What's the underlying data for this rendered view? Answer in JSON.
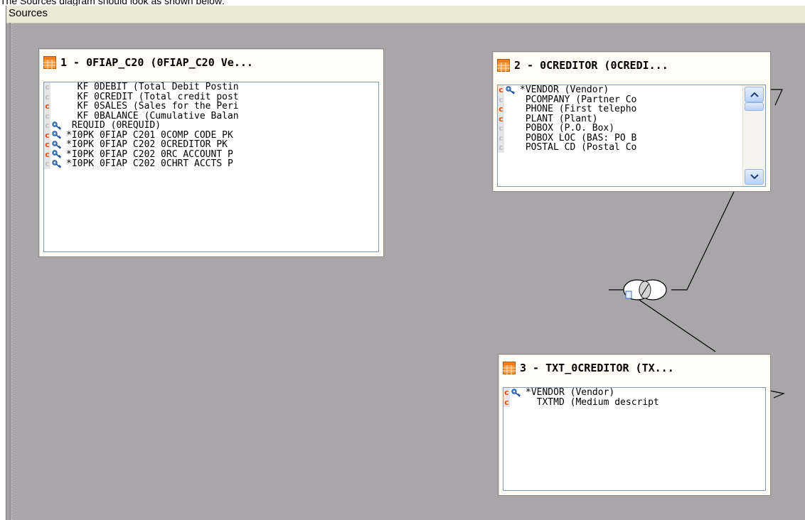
{
  "caption": "The Sources diagram should look as shown below:",
  "panel": {
    "title": "Sources"
  },
  "colors": {
    "canvas": "#a8a6a8",
    "column_marker_red": "#e0501a",
    "table_icon": "#f08a2a"
  },
  "tables": [
    {
      "title": "1 - 0FIAP_C20 (0FIAP_C20 Ve...",
      "rows": [
        {
          "marker": "grey",
          "key": false,
          "text": "  KF 0DEBIT (Total Debit Postin"
        },
        {
          "marker": "grey",
          "key": false,
          "text": "  KF 0CREDIT (Total credit post"
        },
        {
          "marker": "red",
          "key": false,
          "text": "  KF 0SALES (Sales for the Peri"
        },
        {
          "marker": "grey",
          "key": false,
          "text": "  KF 0BALANCE (Cumulative Balan"
        },
        {
          "marker": "grey",
          "key": true,
          "text": " REQUID (0REQUID)"
        },
        {
          "marker": "red",
          "key": true,
          "text": "*I0PK 0FIAP C201 0COMP CODE PK"
        },
        {
          "marker": "red",
          "key": true,
          "text": "*I0PK 0FIAP C202 0CREDITOR PK"
        },
        {
          "marker": "red",
          "key": true,
          "text": "*I0PK 0FIAP C202 0RC ACCOUNT P"
        },
        {
          "marker": "grey",
          "key": true,
          "text": "*I0PK 0FIAP C202 0CHRT ACCTS P"
        }
      ]
    },
    {
      "title": "2 - 0CREDITOR (0CREDI...",
      "rows": [
        {
          "marker": "red",
          "key": true,
          "text": "*VENDOR (Vendor)"
        },
        {
          "marker": "grey",
          "key": false,
          "text": " PCOMPANY (Partner Co"
        },
        {
          "marker": "red",
          "key": false,
          "text": " PHONE (First telepho"
        },
        {
          "marker": "red",
          "key": false,
          "text": " PLANT (Plant)"
        },
        {
          "marker": "grey",
          "key": false,
          "text": " POBOX (P.O. Box)"
        },
        {
          "marker": "grey",
          "key": false,
          "text": " POBOX LOC (BAS: PO B"
        },
        {
          "marker": "grey",
          "key": false,
          "text": " POSTAL CD (Postal Co"
        }
      ]
    },
    {
      "title": "3 - TXT_0CREDITOR (TX...",
      "rows": [
        {
          "marker": "red",
          "key": true,
          "text": "*VENDOR (Vendor)"
        },
        {
          "marker": "red",
          "key": false,
          "text": "  TXTMD (Medium descript"
        }
      ]
    }
  ],
  "icons": {
    "table": "table-grid-icon",
    "key": "key-icon",
    "join": "join-icon",
    "scroll_up": "scroll-up-arrow-icon",
    "scroll_down": "scroll-down-arrow-icon"
  }
}
